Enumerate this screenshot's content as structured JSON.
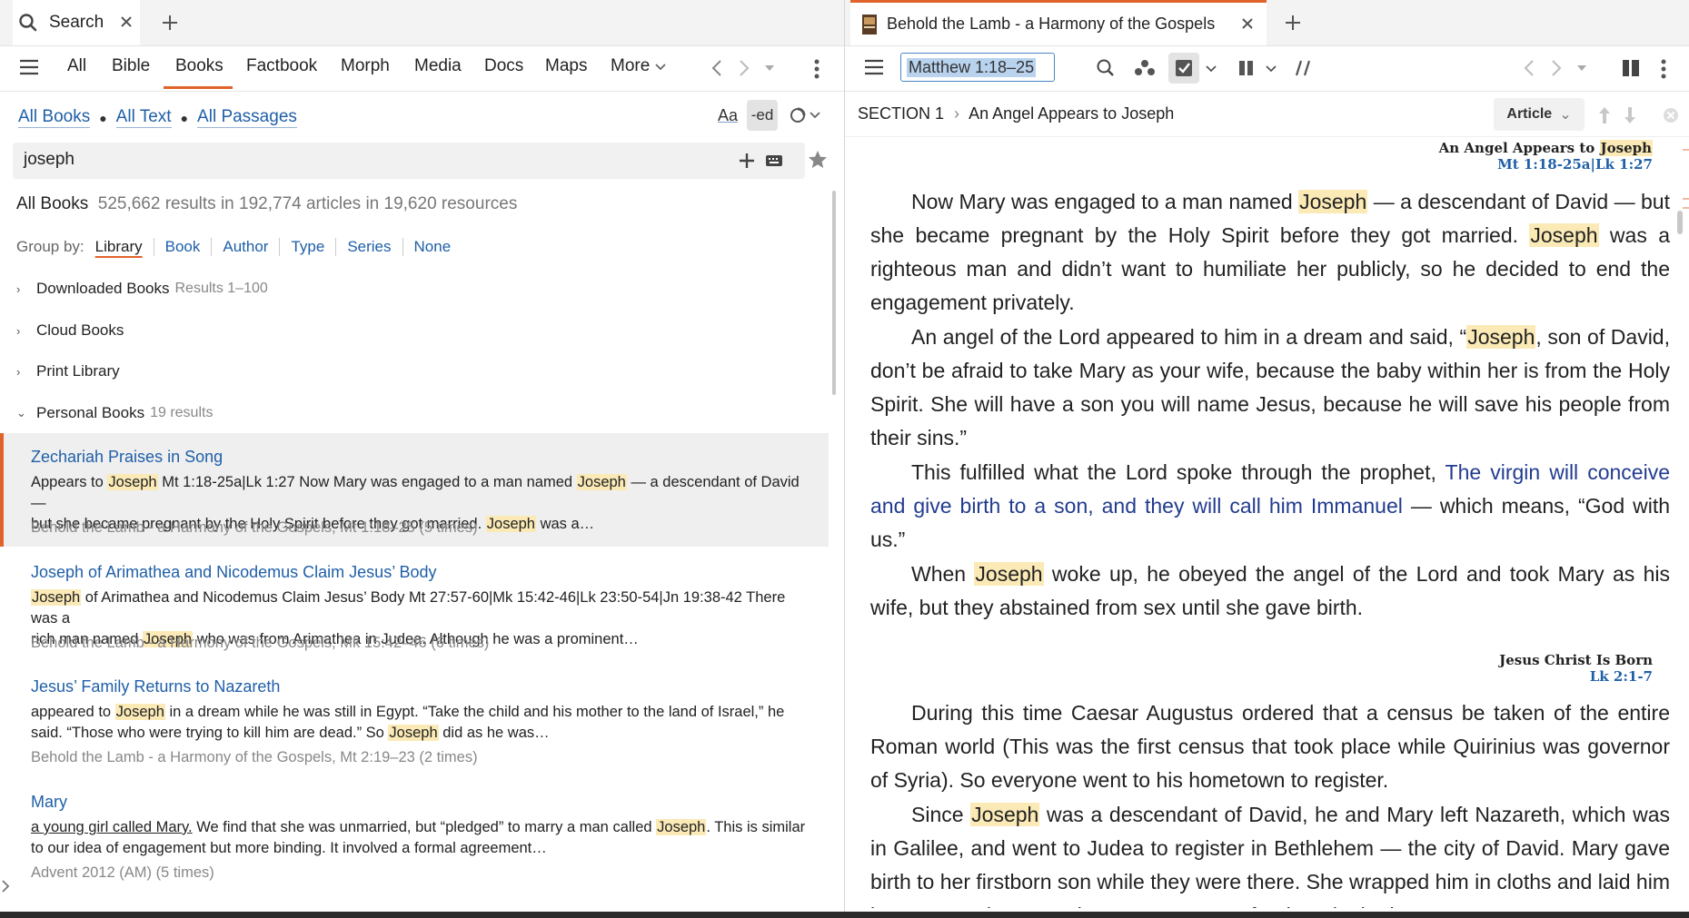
{
  "left": {
    "tab": {
      "icon": "search-icon",
      "label": "Search"
    },
    "nav": [
      "All",
      "Bible",
      "Books",
      "Factbook",
      "Morph",
      "Media",
      "Docs",
      "Maps",
      "More"
    ],
    "scope": {
      "all_books": "All Books",
      "all_text": "All Text",
      "all_passages": "All Passages"
    },
    "format_buttons": {
      "aa": "Aa",
      "ed": "-ed"
    },
    "search_value": "joseph",
    "summary": {
      "label": "All Books",
      "counts": "525,662 results in 192,774 articles in 19,620 resources"
    },
    "group_by": {
      "label": "Group by:",
      "options": [
        "Library",
        "Book",
        "Author",
        "Type",
        "Series",
        "None"
      ],
      "active": "Library"
    },
    "groups": [
      {
        "name": "Downloaded Books",
        "count": "Results 1–100",
        "expanded": false
      },
      {
        "name": "Cloud Books",
        "count": "",
        "expanded": false
      },
      {
        "name": "Print Library",
        "count": "",
        "expanded": false
      },
      {
        "name": "Personal Books",
        "count": "19 results",
        "expanded": true
      }
    ],
    "results": [
      {
        "title": "Zechariah Praises in Song",
        "s1a": "Appears to ",
        "s1m": "Joseph",
        "s1b": " Mt 1:18-25a|Lk 1:27 Now Mary was engaged to a man named ",
        "s1m2": "Joseph",
        "s1c": " — a descendant of David —",
        "s2a": "but she became pregnant by the Holy Spirit before they got married. ",
        "s2m": "Joseph",
        "s2b": " was a…",
        "source": "Behold the Lamb - a Harmony of the Gospels, Mt 1:18–25 (5 times)"
      },
      {
        "title": "Joseph of Arimathea and Nicodemus Claim Jesus’ Body",
        "s1a": "",
        "s1m": "Joseph",
        "s1b": " of Arimathea and Nicodemus Claim Jesus’ Body Mt 27:57-60|Mk 15:42-46|Lk 23:50-54|Jn 19:38-42 There was a",
        "s1m2": "",
        "s1c": "",
        "s2a": "rich man named ",
        "s2m": "Joseph",
        "s2b": " who was from Arimathea in Judea. Although he was a prominent…",
        "source": "Behold the Lamb - a Harmony of the Gospels, Mk 15:42–46 (6 times)"
      },
      {
        "title": "Jesus’ Family Returns to Nazareth",
        "s1a": "appeared to ",
        "s1m": "Joseph",
        "s1b": " in a dream while he was still in Egypt. “Take the child and his mother to the land of Israel,” he",
        "s1m2": "",
        "s1c": "",
        "s2a": "said. “Those who were trying to kill him are dead.” So ",
        "s2m": "Joseph",
        "s2b": " did as he was…",
        "source": "Behold the Lamb - a Harmony of the Gospels, Mt 2:19–23 (2 times)"
      },
      {
        "title": "Mary",
        "s1a": "a young girl called Mary.",
        "s1m": "",
        "s1b": " We find that she was unmarried, but “pledged” to marry a man called ",
        "s1m2": "Joseph",
        "s1c": ". This is similar",
        "s2a": "to our idea of engagement but more binding. It involved a formal agreement…",
        "s2m": "",
        "s2b": "",
        "source": "Advent 2012 (AM) (5 times)"
      }
    ]
  },
  "right": {
    "tab": {
      "title": "Behold the Lamb - a Harmony of the Gospels"
    },
    "reference": "Matthew 1:18–25",
    "section": {
      "label": "SECTION 1",
      "title": "An Angel Appears to Joseph"
    },
    "view_mode": "Article",
    "heading1": {
      "pre": "An Angel Appears to ",
      "name": "Joseph",
      "ref": "Mt 1:18-25a|Lk 1:27"
    },
    "p1": {
      "a": "Now Mary was engaged to a man named ",
      "m1": "Joseph",
      "b": " — a descendant of David — but she became pregnant by the Holy Spirit before they got married. ",
      "m2": "Joseph",
      "c": " was a righteous man and didn’t want to humiliate her publicly, so he decided to end the engagement privately."
    },
    "p2": {
      "a": "An angel of the Lord appeared to him in a dream and said, “",
      "m1": "Joseph",
      "b": ", son of David, don’t be afraid to take Mary as your wife, because the baby within her is from the Holy Spirit. She will have a son you will name Jesus, because he will save his people from their sins.”"
    },
    "p3": {
      "a": "This fulfilled what the Lord spoke through the prophet, ",
      "q": "The virgin will con­ceive and give birth to a son, and they will call him Immanuel",
      "b": " — which means, “God with us.”"
    },
    "p4": {
      "a": "When ",
      "m1": "Joseph",
      "b": " woke up, he obeyed the angel of the Lord and took Mary as his wife, but they abstained from sex until she gave birth."
    },
    "heading2": {
      "title": "Jesus Christ Is Born",
      "ref": "Lk 2:1-7"
    },
    "p5": {
      "a": "During this time Caesar Augustus ordered that a census be taken of the entire Roman world (This was the first census that took place while Quirinius was gover­nor of Syria). So everyone went to his hometown to register."
    },
    "p6": {
      "a": "Since ",
      "m1": "Joseph",
      "b": " was a descendant of David, he and Mary left Nazareth, which was in Galilee, and went to Judea to register in Bethlehem — the city of David. Mary gave birth to her firstborn son while they were there. She wrapped him in cloths and laid him in a manger because there was no room for them in the inn."
    }
  },
  "colors": {
    "accent": "#e0632b",
    "link": "#1f5fa8",
    "highlight": "#fbeab6",
    "quote": "#223b8f"
  }
}
